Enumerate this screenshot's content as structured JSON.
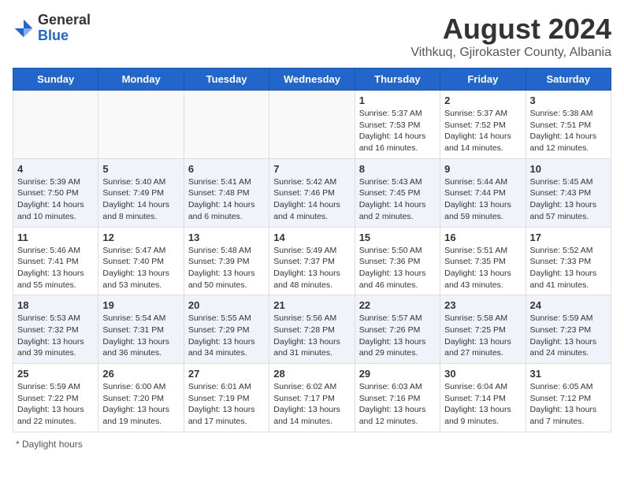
{
  "header": {
    "logo_general": "General",
    "logo_blue": "Blue",
    "title": "August 2024",
    "subtitle": "Vithkuq, Gjirokaster County, Albania"
  },
  "days_of_week": [
    "Sunday",
    "Monday",
    "Tuesday",
    "Wednesday",
    "Thursday",
    "Friday",
    "Saturday"
  ],
  "weeks": [
    [
      {
        "day": "",
        "info": ""
      },
      {
        "day": "",
        "info": ""
      },
      {
        "day": "",
        "info": ""
      },
      {
        "day": "",
        "info": ""
      },
      {
        "day": "1",
        "info": "Sunrise: 5:37 AM\nSunset: 7:53 PM\nDaylight: 14 hours and 16 minutes."
      },
      {
        "day": "2",
        "info": "Sunrise: 5:37 AM\nSunset: 7:52 PM\nDaylight: 14 hours and 14 minutes."
      },
      {
        "day": "3",
        "info": "Sunrise: 5:38 AM\nSunset: 7:51 PM\nDaylight: 14 hours and 12 minutes."
      }
    ],
    [
      {
        "day": "4",
        "info": "Sunrise: 5:39 AM\nSunset: 7:50 PM\nDaylight: 14 hours and 10 minutes."
      },
      {
        "day": "5",
        "info": "Sunrise: 5:40 AM\nSunset: 7:49 PM\nDaylight: 14 hours and 8 minutes."
      },
      {
        "day": "6",
        "info": "Sunrise: 5:41 AM\nSunset: 7:48 PM\nDaylight: 14 hours and 6 minutes."
      },
      {
        "day": "7",
        "info": "Sunrise: 5:42 AM\nSunset: 7:46 PM\nDaylight: 14 hours and 4 minutes."
      },
      {
        "day": "8",
        "info": "Sunrise: 5:43 AM\nSunset: 7:45 PM\nDaylight: 14 hours and 2 minutes."
      },
      {
        "day": "9",
        "info": "Sunrise: 5:44 AM\nSunset: 7:44 PM\nDaylight: 13 hours and 59 minutes."
      },
      {
        "day": "10",
        "info": "Sunrise: 5:45 AM\nSunset: 7:43 PM\nDaylight: 13 hours and 57 minutes."
      }
    ],
    [
      {
        "day": "11",
        "info": "Sunrise: 5:46 AM\nSunset: 7:41 PM\nDaylight: 13 hours and 55 minutes."
      },
      {
        "day": "12",
        "info": "Sunrise: 5:47 AM\nSunset: 7:40 PM\nDaylight: 13 hours and 53 minutes."
      },
      {
        "day": "13",
        "info": "Sunrise: 5:48 AM\nSunset: 7:39 PM\nDaylight: 13 hours and 50 minutes."
      },
      {
        "day": "14",
        "info": "Sunrise: 5:49 AM\nSunset: 7:37 PM\nDaylight: 13 hours and 48 minutes."
      },
      {
        "day": "15",
        "info": "Sunrise: 5:50 AM\nSunset: 7:36 PM\nDaylight: 13 hours and 46 minutes."
      },
      {
        "day": "16",
        "info": "Sunrise: 5:51 AM\nSunset: 7:35 PM\nDaylight: 13 hours and 43 minutes."
      },
      {
        "day": "17",
        "info": "Sunrise: 5:52 AM\nSunset: 7:33 PM\nDaylight: 13 hours and 41 minutes."
      }
    ],
    [
      {
        "day": "18",
        "info": "Sunrise: 5:53 AM\nSunset: 7:32 PM\nDaylight: 13 hours and 39 minutes."
      },
      {
        "day": "19",
        "info": "Sunrise: 5:54 AM\nSunset: 7:31 PM\nDaylight: 13 hours and 36 minutes."
      },
      {
        "day": "20",
        "info": "Sunrise: 5:55 AM\nSunset: 7:29 PM\nDaylight: 13 hours and 34 minutes."
      },
      {
        "day": "21",
        "info": "Sunrise: 5:56 AM\nSunset: 7:28 PM\nDaylight: 13 hours and 31 minutes."
      },
      {
        "day": "22",
        "info": "Sunrise: 5:57 AM\nSunset: 7:26 PM\nDaylight: 13 hours and 29 minutes."
      },
      {
        "day": "23",
        "info": "Sunrise: 5:58 AM\nSunset: 7:25 PM\nDaylight: 13 hours and 27 minutes."
      },
      {
        "day": "24",
        "info": "Sunrise: 5:59 AM\nSunset: 7:23 PM\nDaylight: 13 hours and 24 minutes."
      }
    ],
    [
      {
        "day": "25",
        "info": "Sunrise: 5:59 AM\nSunset: 7:22 PM\nDaylight: 13 hours and 22 minutes."
      },
      {
        "day": "26",
        "info": "Sunrise: 6:00 AM\nSunset: 7:20 PM\nDaylight: 13 hours and 19 minutes."
      },
      {
        "day": "27",
        "info": "Sunrise: 6:01 AM\nSunset: 7:19 PM\nDaylight: 13 hours and 17 minutes."
      },
      {
        "day": "28",
        "info": "Sunrise: 6:02 AM\nSunset: 7:17 PM\nDaylight: 13 hours and 14 minutes."
      },
      {
        "day": "29",
        "info": "Sunrise: 6:03 AM\nSunset: 7:16 PM\nDaylight: 13 hours and 12 minutes."
      },
      {
        "day": "30",
        "info": "Sunrise: 6:04 AM\nSunset: 7:14 PM\nDaylight: 13 hours and 9 minutes."
      },
      {
        "day": "31",
        "info": "Sunrise: 6:05 AM\nSunset: 7:12 PM\nDaylight: 13 hours and 7 minutes."
      }
    ]
  ],
  "footer": {
    "note": "* Daylight hours"
  }
}
